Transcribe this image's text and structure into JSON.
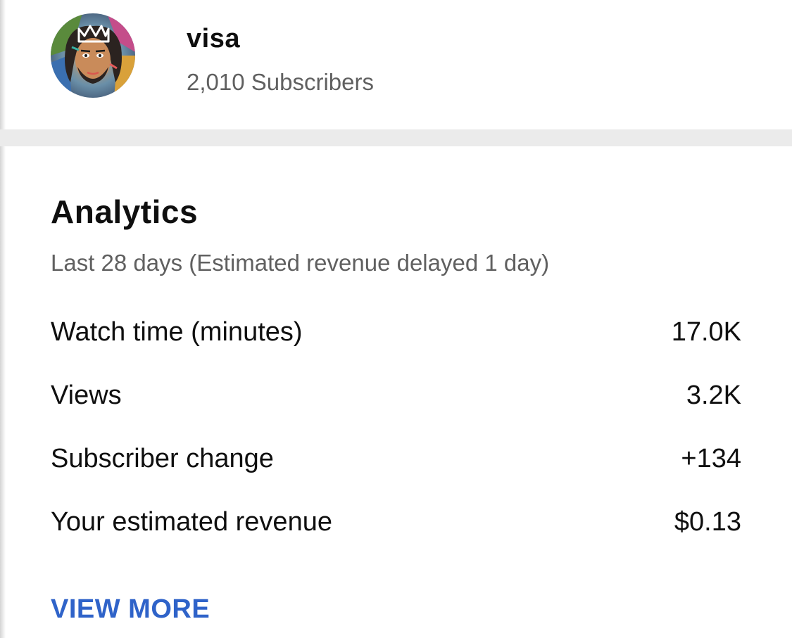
{
  "channel": {
    "name": "visa",
    "subscribers": "2,010 Subscribers",
    "avatar_icon": "channel-avatar-portrait"
  },
  "analytics": {
    "title": "Analytics",
    "subtitle": "Last 28 days (Estimated revenue delayed 1 day)",
    "metrics": [
      {
        "label": "Watch time (minutes)",
        "value": "17.0K"
      },
      {
        "label": "Views",
        "value": "3.2K"
      },
      {
        "label": "Subscriber change",
        "value": "+134"
      },
      {
        "label": "Your estimated revenue",
        "value": "$0.13"
      }
    ],
    "view_more_label": "VIEW MORE"
  },
  "colors": {
    "link": "#2f63c9",
    "primary_text": "#0f0f0f",
    "secondary_text": "#606060",
    "divider": "#ebebeb"
  }
}
